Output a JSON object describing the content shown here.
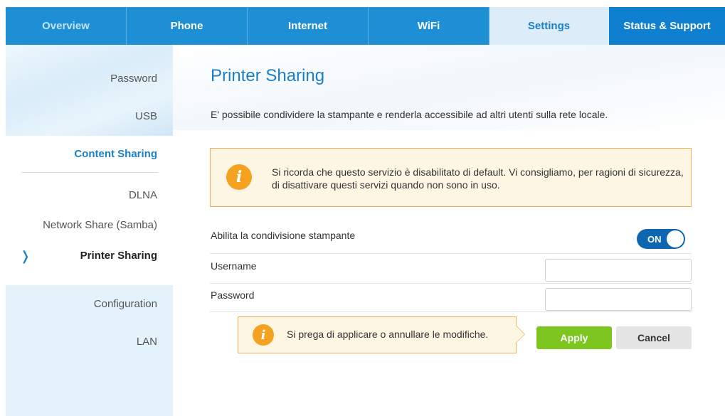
{
  "topnav": {
    "tabs": [
      {
        "label": "Overview"
      },
      {
        "label": "Phone"
      },
      {
        "label": "Internet"
      },
      {
        "label": "WiFi"
      },
      {
        "label": "Settings"
      },
      {
        "label": "Status & Support"
      }
    ],
    "active_tab": "Settings"
  },
  "sidebar": {
    "password": "Password",
    "usb": "USB",
    "content_sharing": "Content Sharing",
    "dlna": "DLNA",
    "network_share": "Network Share (Samba)",
    "printer_sharing": "Printer Sharing",
    "configuration": "Configuration",
    "lan": "LAN",
    "current_icon": "chevron-right-icon"
  },
  "main": {
    "title": "Printer Sharing",
    "description": "E' possibile condividere la stampante e renderla accessibile ad altri utenti sulla rete locale.",
    "notice_icon": "info-icon",
    "notice_text": "Si ricorda che questo servizio è disabilitato di default. Vi consigliamo, per ragioni di sicurezza, di disattivare questi servizi quando non sono in uso.",
    "enable_label": "Abilita la condivisione stampante",
    "toggle_label": "ON",
    "toggle_state": true,
    "username_label": "Username",
    "username_value": "",
    "password_label": "Password",
    "password_value": "",
    "apply_notice_text": "Si prega di applicare o annullare le modifiche.",
    "apply_label": "Apply",
    "cancel_label": "Cancel"
  },
  "colors": {
    "nav_blue": "#1f8fd5",
    "accent_blue": "#1a7fc4",
    "warning_orange": "#f4a21f",
    "apply_green": "#7cc61f"
  }
}
